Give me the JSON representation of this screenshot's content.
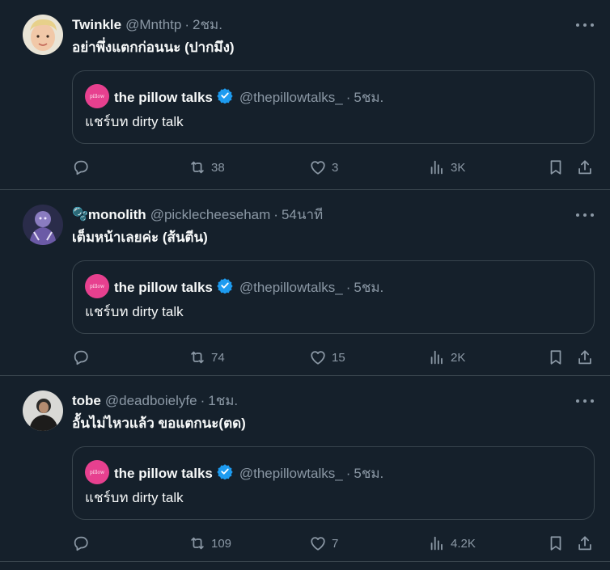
{
  "quoted_source": {
    "name": "the pillow talks",
    "handle": "@thepillowtalks_",
    "time": "5ชม.",
    "text": "แชร์บท dirty talk",
    "avatar_text": "pillow",
    "avatar_color": "#e7408f"
  },
  "tweets": [
    {
      "name": "Twinkle",
      "handle": "@Mnthtp",
      "time": "2ชม.",
      "text": "อย่าพึ่งแตกก่อนนะ (ปากมึง)",
      "replies": "",
      "retweets": "38",
      "likes": "3",
      "views": "3K"
    },
    {
      "name_emoji": "🫧",
      "name": "monolith",
      "handle": "@picklecheeseham",
      "time": "54นาที",
      "text": "เต็มหน้าเลยค่ะ (ส้นตีน)",
      "replies": "",
      "retweets": "74",
      "likes": "15",
      "views": "2K"
    },
    {
      "name": "tobe",
      "handle": "@deadboielyfe",
      "time": "1ชม.",
      "text": "อั้นไม่ไหวแล้ว ขอแตกนะ(ตด)",
      "replies": "",
      "retweets": "109",
      "likes": "7",
      "views": "4.2K"
    }
  ],
  "colors": {
    "background": "#15202b",
    "border": "#38444d",
    "muted": "#8b98a5",
    "text": "#f7f9f9",
    "verified": "#1d9bf0"
  }
}
